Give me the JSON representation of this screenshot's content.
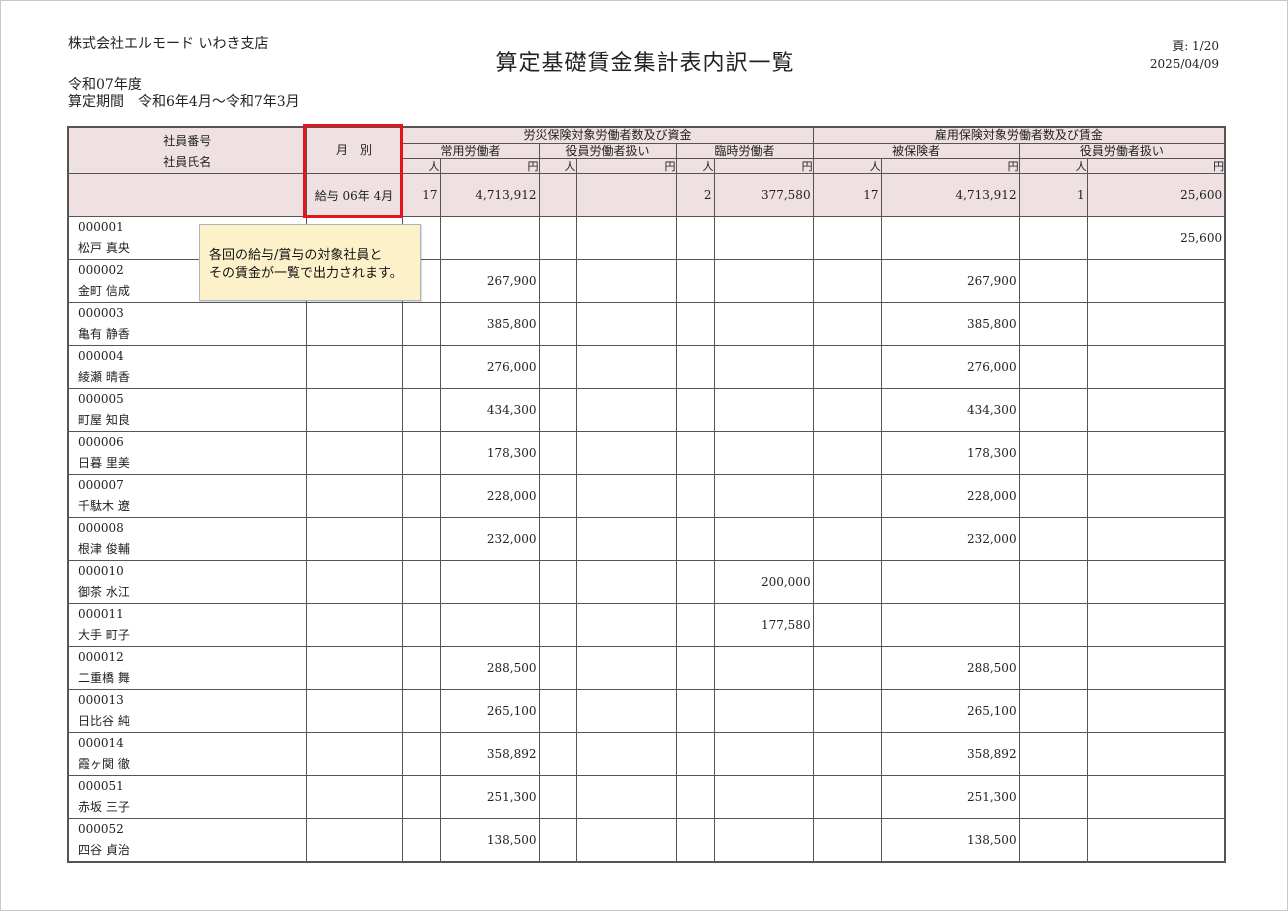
{
  "header": {
    "company": "株式会社エルモード いわき支店",
    "title": "算定基礎賃金集計表内訳一覧",
    "page": "頁: 1/20",
    "date": "2025/04/09",
    "fiscal_year": "令和07年度",
    "period": "算定期間　令和6年4月～令和7年3月"
  },
  "columns": {
    "emp_no": "社員番号",
    "emp_name": "社員氏名",
    "month": "月　別",
    "rousai_group": "労災保険対象労働者数及び資金",
    "koyou_group": "雇用保険対象労働者数及び賃金",
    "regular": "常用労働者",
    "officer": "役員労働者扱い",
    "temporary": "臨時労働者",
    "insured": "被保険者",
    "officer2": "役員労働者扱い",
    "unit_person": "人",
    "unit_yen": "円"
  },
  "total": {
    "month": "給与 06年 4月",
    "regular_people": "17",
    "regular_yen": "4,713,912",
    "officer_people": "",
    "officer_yen": "",
    "temp_people": "2",
    "temp_yen": "377,580",
    "insured_people": "17",
    "insured_yen": "4,713,912",
    "officer2_people": "1",
    "officer2_yen": "25,600"
  },
  "rows": [
    {
      "no": "000001",
      "name": "松戸 真央",
      "regular_yen": "",
      "temp_yen": "",
      "insured_yen": "",
      "officer2_yen": "25,600"
    },
    {
      "no": "000002",
      "name": "金町 信成",
      "regular_yen": "267,900",
      "temp_yen": "",
      "insured_yen": "267,900",
      "officer2_yen": ""
    },
    {
      "no": "000003",
      "name": "亀有 静香",
      "regular_yen": "385,800",
      "temp_yen": "",
      "insured_yen": "385,800",
      "officer2_yen": ""
    },
    {
      "no": "000004",
      "name": "綾瀬 晴香",
      "regular_yen": "276,000",
      "temp_yen": "",
      "insured_yen": "276,000",
      "officer2_yen": ""
    },
    {
      "no": "000005",
      "name": "町屋 知良",
      "regular_yen": "434,300",
      "temp_yen": "",
      "insured_yen": "434,300",
      "officer2_yen": ""
    },
    {
      "no": "000006",
      "name": "日暮 里美",
      "regular_yen": "178,300",
      "temp_yen": "",
      "insured_yen": "178,300",
      "officer2_yen": ""
    },
    {
      "no": "000007",
      "name": "千駄木 遼",
      "regular_yen": "228,000",
      "temp_yen": "",
      "insured_yen": "228,000",
      "officer2_yen": ""
    },
    {
      "no": "000008",
      "name": "根津 俊輔",
      "regular_yen": "232,000",
      "temp_yen": "",
      "insured_yen": "232,000",
      "officer2_yen": ""
    },
    {
      "no": "000010",
      "name": "御茶 水江",
      "regular_yen": "",
      "temp_yen": "200,000",
      "insured_yen": "",
      "officer2_yen": ""
    },
    {
      "no": "000011",
      "name": "大手 町子",
      "regular_yen": "",
      "temp_yen": "177,580",
      "insured_yen": "",
      "officer2_yen": ""
    },
    {
      "no": "000012",
      "name": "二重橋 舞",
      "regular_yen": "288,500",
      "temp_yen": "",
      "insured_yen": "288,500",
      "officer2_yen": ""
    },
    {
      "no": "000013",
      "name": "日比谷 純",
      "regular_yen": "265,100",
      "temp_yen": "",
      "insured_yen": "265,100",
      "officer2_yen": ""
    },
    {
      "no": "000014",
      "name": "霞ヶ関 徹",
      "regular_yen": "358,892",
      "temp_yen": "",
      "insured_yen": "358,892",
      "officer2_yen": ""
    },
    {
      "no": "000051",
      "name": "赤坂 三子",
      "regular_yen": "251,300",
      "temp_yen": "",
      "insured_yen": "251,300",
      "officer2_yen": ""
    },
    {
      "no": "000052",
      "name": "四谷 貞治",
      "regular_yen": "138,500",
      "temp_yen": "",
      "insured_yen": "138,500",
      "officer2_yen": ""
    }
  ],
  "callout": {
    "text": "各回の給与/賞与の対象社員と\nその賃金が一覧で出力されます。",
    "highlight_color": "#e2141c",
    "background_color": "#fdf1c9"
  },
  "colors": {
    "header_bg": "#efe0e2",
    "border": "#555555"
  }
}
